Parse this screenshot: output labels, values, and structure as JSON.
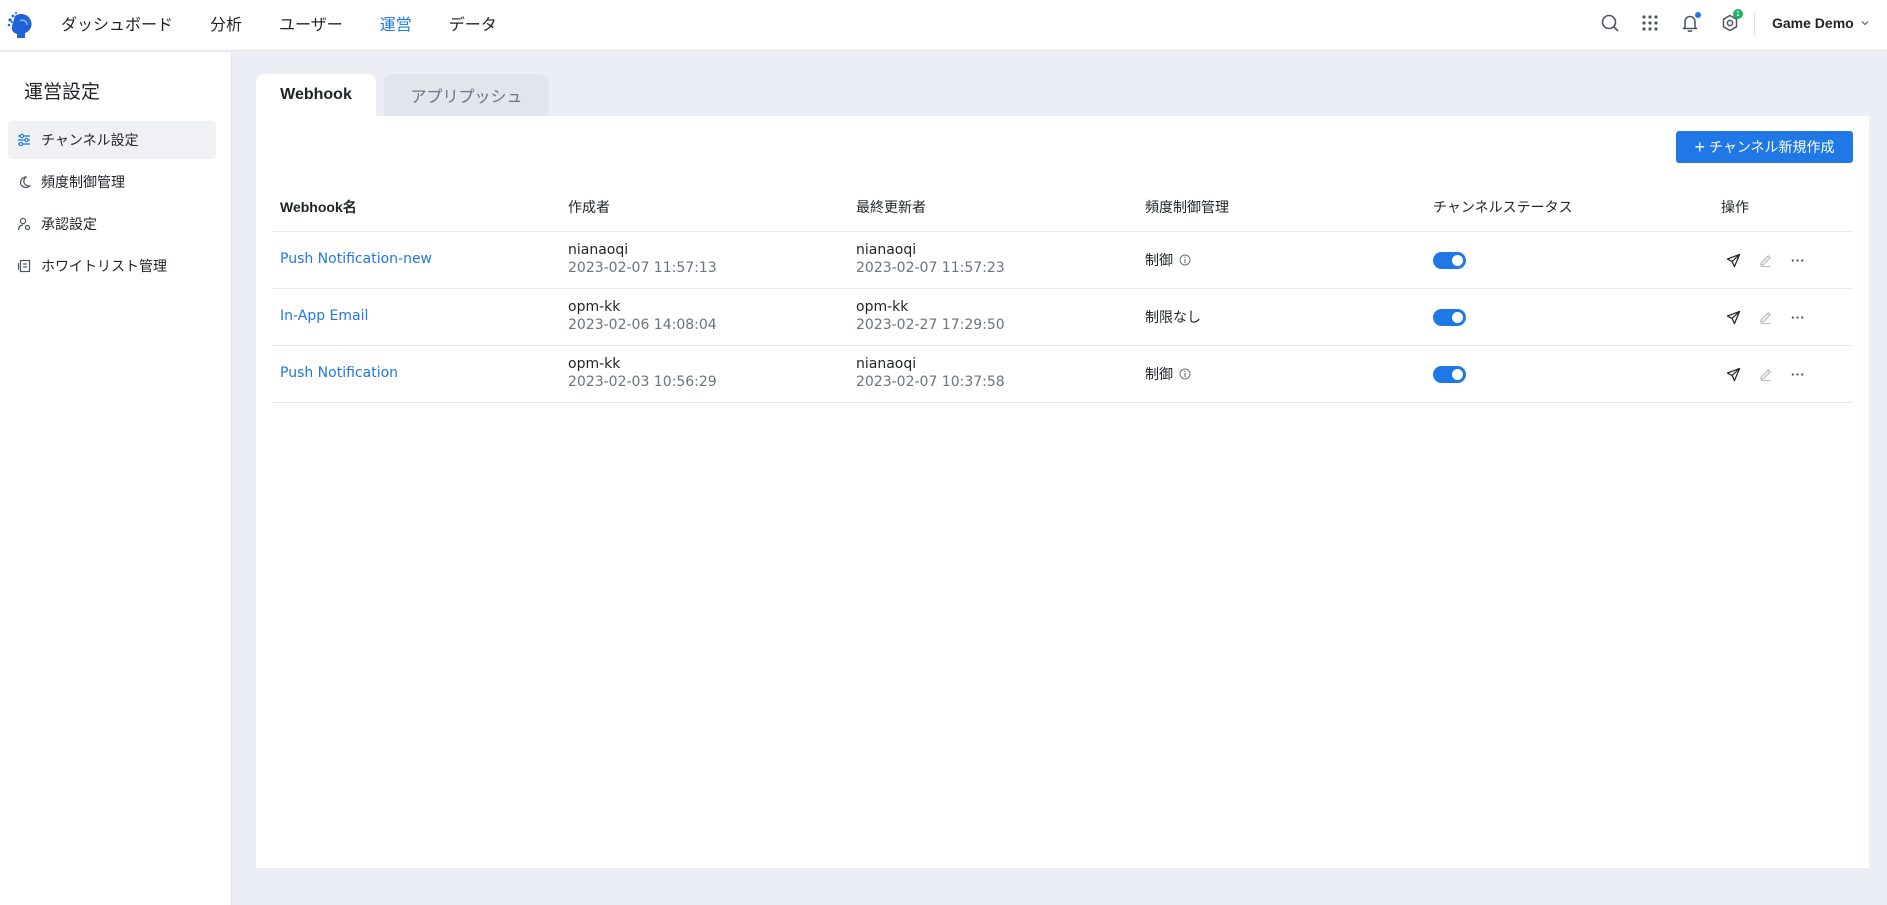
{
  "nav": {
    "items": [
      {
        "label": "ダッシュボード",
        "active": false
      },
      {
        "label": "分析",
        "active": false
      },
      {
        "label": "ユーザー",
        "active": false
      },
      {
        "label": "運営",
        "active": true
      },
      {
        "label": "データ",
        "active": false
      }
    ],
    "account": "Game Demo",
    "settings_badge": "1"
  },
  "sidebar": {
    "title": "運営設定",
    "items": [
      {
        "label": "チャンネル設定",
        "icon": "sliders-icon",
        "active": true
      },
      {
        "label": "頻度制御管理",
        "icon": "moon-icon",
        "active": false
      },
      {
        "label": "承認設定",
        "icon": "user-settings-icon",
        "active": false
      },
      {
        "label": "ホワイトリスト管理",
        "icon": "whitelist-icon",
        "active": false
      }
    ]
  },
  "tabs": [
    {
      "label": "Webhook",
      "active": true
    },
    {
      "label": "アプリプッシュ",
      "active": false
    }
  ],
  "actions": {
    "create_label": "チャンネル新規作成"
  },
  "table": {
    "headers": [
      "Webhook名",
      "作成者",
      "最終更新者",
      "頻度制御管理",
      "チャンネルステータス",
      "操作"
    ],
    "rows": [
      {
        "name": "Push Notification-new",
        "creator": "nianaoqi",
        "created": "2023-02-07 11:57:13",
        "updater": "nianaoqi",
        "updated": "2023-02-07 11:57:23",
        "limit": "制御",
        "limit_info": true,
        "status": "on"
      },
      {
        "name": "In-App Email",
        "creator": "opm-kk",
        "created": "2023-02-06 14:08:04",
        "updater": "opm-kk",
        "updated": "2023-02-27 17:29:50",
        "limit": "制限なし",
        "limit_info": false,
        "status": "on"
      },
      {
        "name": "Push Notification",
        "creator": "opm-kk",
        "created": "2023-02-03 10:56:29",
        "updater": "nianaoqi",
        "updated": "2023-02-07 10:37:58",
        "limit": "制御",
        "limit_info": true,
        "status": "on"
      }
    ]
  },
  "colors": {
    "accent": "#1f78e6",
    "background": "#eceef5",
    "success": "#18b565"
  }
}
